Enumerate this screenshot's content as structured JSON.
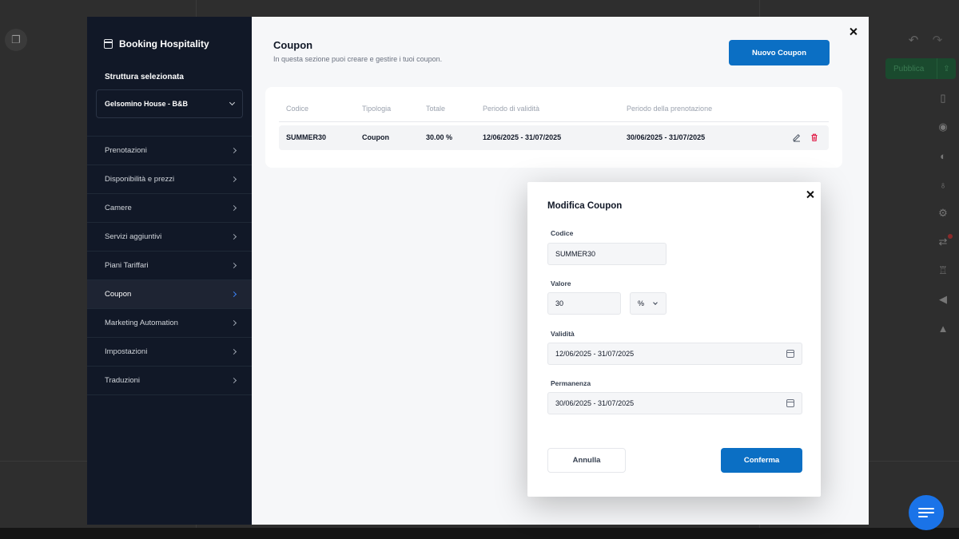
{
  "background": {
    "publish_label": "Pubblica",
    "rail_icons": [
      "mobile-icon",
      "eye-icon",
      "palette-icon",
      "lightbulb-icon",
      "gear-icon",
      "translate-icon",
      "trophy-icon",
      "megaphone-icon",
      "graduation-cap-icon"
    ]
  },
  "sidebar": {
    "brand": "Booking Hospitality",
    "structure_label": "Struttura selezionata",
    "structure_value": "Gelsomino House - B&B",
    "items": [
      {
        "label": "Prenotazioni"
      },
      {
        "label": "Disponibilità e prezzi"
      },
      {
        "label": "Camere"
      },
      {
        "label": "Servizi aggiuntivi"
      },
      {
        "label": "Piani Tariffari"
      },
      {
        "label": "Coupon",
        "active": true
      },
      {
        "label": "Marketing Automation"
      },
      {
        "label": "Impostazioni"
      },
      {
        "label": "Traduzioni"
      }
    ]
  },
  "main": {
    "title": "Coupon",
    "description": "In questa sezione puoi creare e gestire i tuoi coupon.",
    "new_button": "Nuovo Coupon",
    "table": {
      "headers": [
        "Codice",
        "Tipologia",
        "Totale",
        "Periodo di validità",
        "Periodo della prenotazione"
      ],
      "rows": [
        [
          "SUMMER30",
          "Coupon",
          "30.00 %",
          "12/06/2025 - 31/07/2025",
          "30/06/2025 - 31/07/2025"
        ]
      ]
    }
  },
  "dialog": {
    "title": "Modifica Coupon",
    "code_label": "Codice",
    "code_value": "SUMMER30",
    "value_label": "Valore",
    "value_value": "30",
    "unit_value": "%",
    "validity_label": "Validità",
    "validity_value": "12/06/2025 - 31/07/2025",
    "stay_label": "Permanenza",
    "stay_value": "30/06/2025 - 31/07/2025",
    "cancel": "Annulla",
    "confirm": "Conferma"
  },
  "colors": {
    "primary": "#0b6fc4",
    "sidebar_bg": "#111827",
    "delete": "#e11d48"
  }
}
